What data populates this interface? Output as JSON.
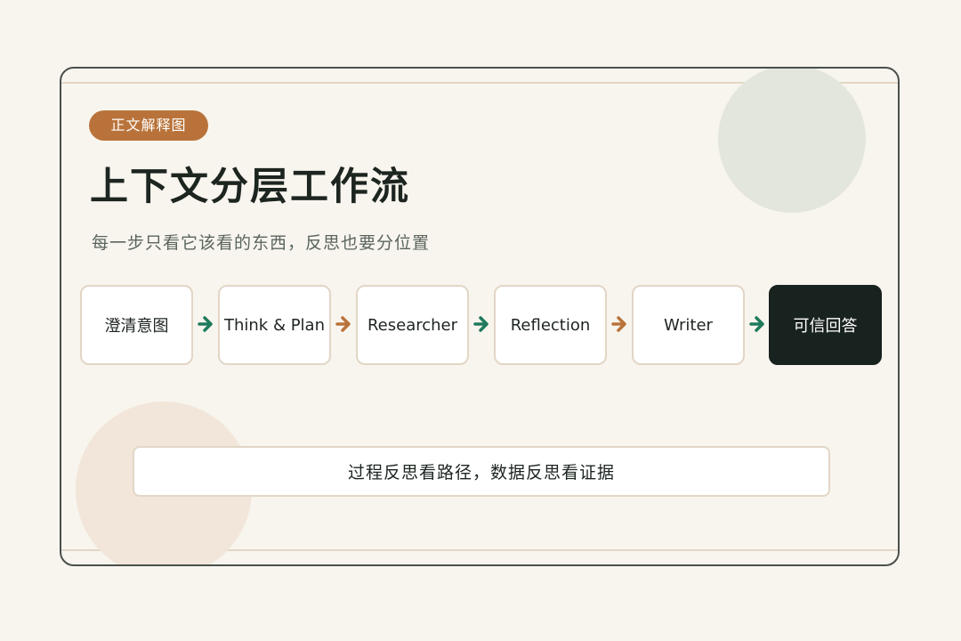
{
  "badge": "正文解释图",
  "title": "上下文分层工作流",
  "subtitle": "每一步只看它该看的东西，反思也要分位置",
  "steps": [
    {
      "label": "澄清意图"
    },
    {
      "label": "Think & Plan"
    },
    {
      "label": "Researcher"
    },
    {
      "label": "Reflection"
    },
    {
      "label": "Writer"
    },
    {
      "label": "可信回答"
    }
  ],
  "arrows": [
    {
      "icon": "arrow-right-icon",
      "color": "#1f7a5c"
    },
    {
      "icon": "arrow-right-icon",
      "color": "#b9733a"
    },
    {
      "icon": "arrow-right-icon",
      "color": "#1f7a5c"
    },
    {
      "icon": "arrow-right-icon",
      "color": "#b9733a"
    },
    {
      "icon": "arrow-right-icon",
      "color": "#1f7a5c"
    }
  ],
  "note": "过程反思看路径，数据反思看证据",
  "colors": {
    "accent": "#b9733a",
    "dark": "#18221e",
    "green": "#1f7a5c"
  }
}
